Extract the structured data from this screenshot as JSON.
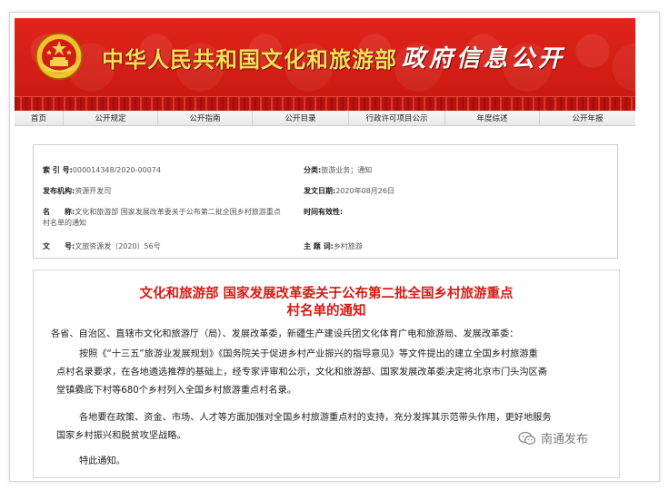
{
  "header": {
    "title_main": "中华人民共和国文化和旅游部",
    "title_sub": "政府信息公开",
    "emblem_icon": "national-emblem-icon",
    "colors": {
      "banner_red": "#d21d14",
      "title_gold": "#f6e05a",
      "doc_title_red": "#d51a14"
    }
  },
  "nav": {
    "items": [
      {
        "label": "首页"
      },
      {
        "label": "公开规定"
      },
      {
        "label": "公开指南"
      },
      {
        "label": "公开目录"
      },
      {
        "label": "行政许可项目公示"
      },
      {
        "label": "年度综述"
      },
      {
        "label": "公开年报"
      }
    ]
  },
  "meta": {
    "index_label": "索 引 号:",
    "index_value": "000014348/2020-00074",
    "category_label": "分类:",
    "category_value": "旅游业务；通知",
    "issuer_label": "发布机构:",
    "issuer_value": "资源开发司",
    "date_label": "发文日期:",
    "date_value": "2020年08月26日",
    "name_label": "名　　称:",
    "name_value_line1": "文化和旅游部 国家发展改革委关于公布第二批全国乡村旅游重点",
    "name_value_line2": "村名单的通知",
    "validity_label": "时间有效性:",
    "validity_value": "",
    "number_label": "文　　号:",
    "number_value": "文旅资源发〔2020〕56号",
    "subject_label": "主 题 词:",
    "subject_value": "乡村旅游"
  },
  "doc": {
    "title_line1": "文化和旅游部 国家发展改革委关于公布第二批全国乡村旅游重点",
    "title_line2": "村名单的通知",
    "addressee": "各省、自治区、直辖市文化和旅游厅（局）、发展改革委，新疆生产建设兵团文化体育广电和旅游局、发展改革委：",
    "para1_line1": "按照《“十三五”旅游业发展规划》《国务院关于促进乡村产业振兴的指导意见》等文件提出的建立全国乡村旅游重",
    "para1_line2": "点村名录要求，在各地遴选推荐的基础上，经专家评审和公示，文化和旅游部、国家发展改革委决定将北京市门头沟区斋",
    "para1_line3": "堂镇爨底下村等680个乡村列入全国乡村旅游重点村名录。",
    "para2_line1": "各地要在政策、资金、市场、人才等方面加强对全国乡村旅游重点村的支持，充分发挥其示范带头作用，更好地服务",
    "para2_line2": "国家乡村振兴和脱贫攻坚战略。",
    "closing": "特此通知。"
  },
  "watermark": {
    "icon": "wechat-icon",
    "label": "南通发布"
  }
}
